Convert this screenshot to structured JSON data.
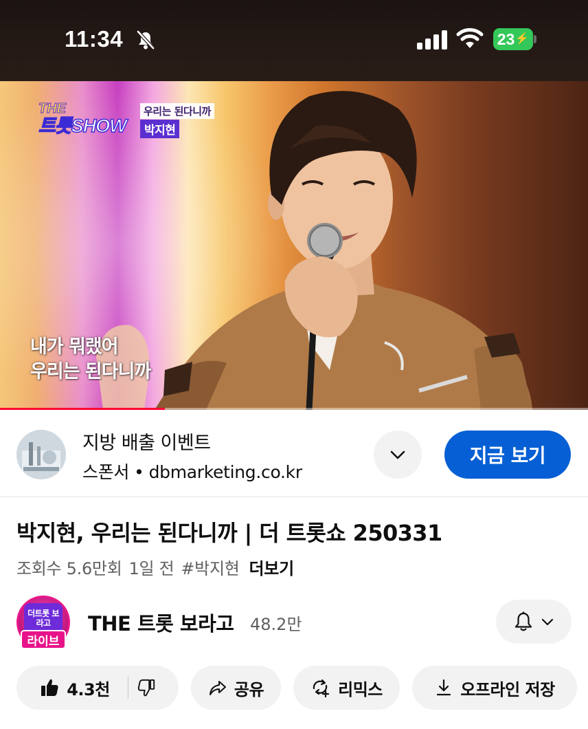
{
  "status_bar": {
    "time": "11:34",
    "silent_icon": "bell-slash-icon",
    "signal_icon": "cellular-signal-icon",
    "wifi_icon": "wifi-icon",
    "battery_level": "23",
    "battery_charging": true,
    "battery_color": "#34c759"
  },
  "video": {
    "show_logo_top": "THE",
    "show_logo_bottom": "트롯SHOW",
    "song_title_tag": "우리는 된다니까",
    "singer_tag": "박지현",
    "lyric_line1": "내가 뭐랬어",
    "lyric_line2": "우리는 된다니까",
    "progress_fraction": 0.28,
    "progress_color": "#ff0033"
  },
  "ad": {
    "title": "지방 배출 이벤트",
    "sponsor_label": "스폰서",
    "separator": "•",
    "domain": "dbmarketing.co.kr",
    "expand_icon": "chevron-down-icon",
    "cta_label": "지금 보기",
    "cta_color": "#065fd4"
  },
  "video_info": {
    "title": "박지현, 우리는 된다니까 | 더 트롯쇼 250331",
    "views": "조회수 5.6만회",
    "age": "1일 전",
    "hashtag": "#박지현",
    "more_label": "더보기"
  },
  "channel": {
    "avatar_text": "더트롯 보라고",
    "live_badge": "라이브",
    "name": "THE 트롯 보라고",
    "subscribers": "48.2만",
    "bell_icon": "bell-icon",
    "dropdown_icon": "chevron-down-icon"
  },
  "actions": {
    "like_count": "4.3천",
    "like_icon": "thumbs-up-icon",
    "dislike_icon": "thumbs-down-icon",
    "share_label": "공유",
    "share_icon": "share-arrow-icon",
    "remix_label": "리믹스",
    "remix_icon": "remix-icon",
    "download_label": "오프라인 저장",
    "download_icon": "download-icon"
  }
}
